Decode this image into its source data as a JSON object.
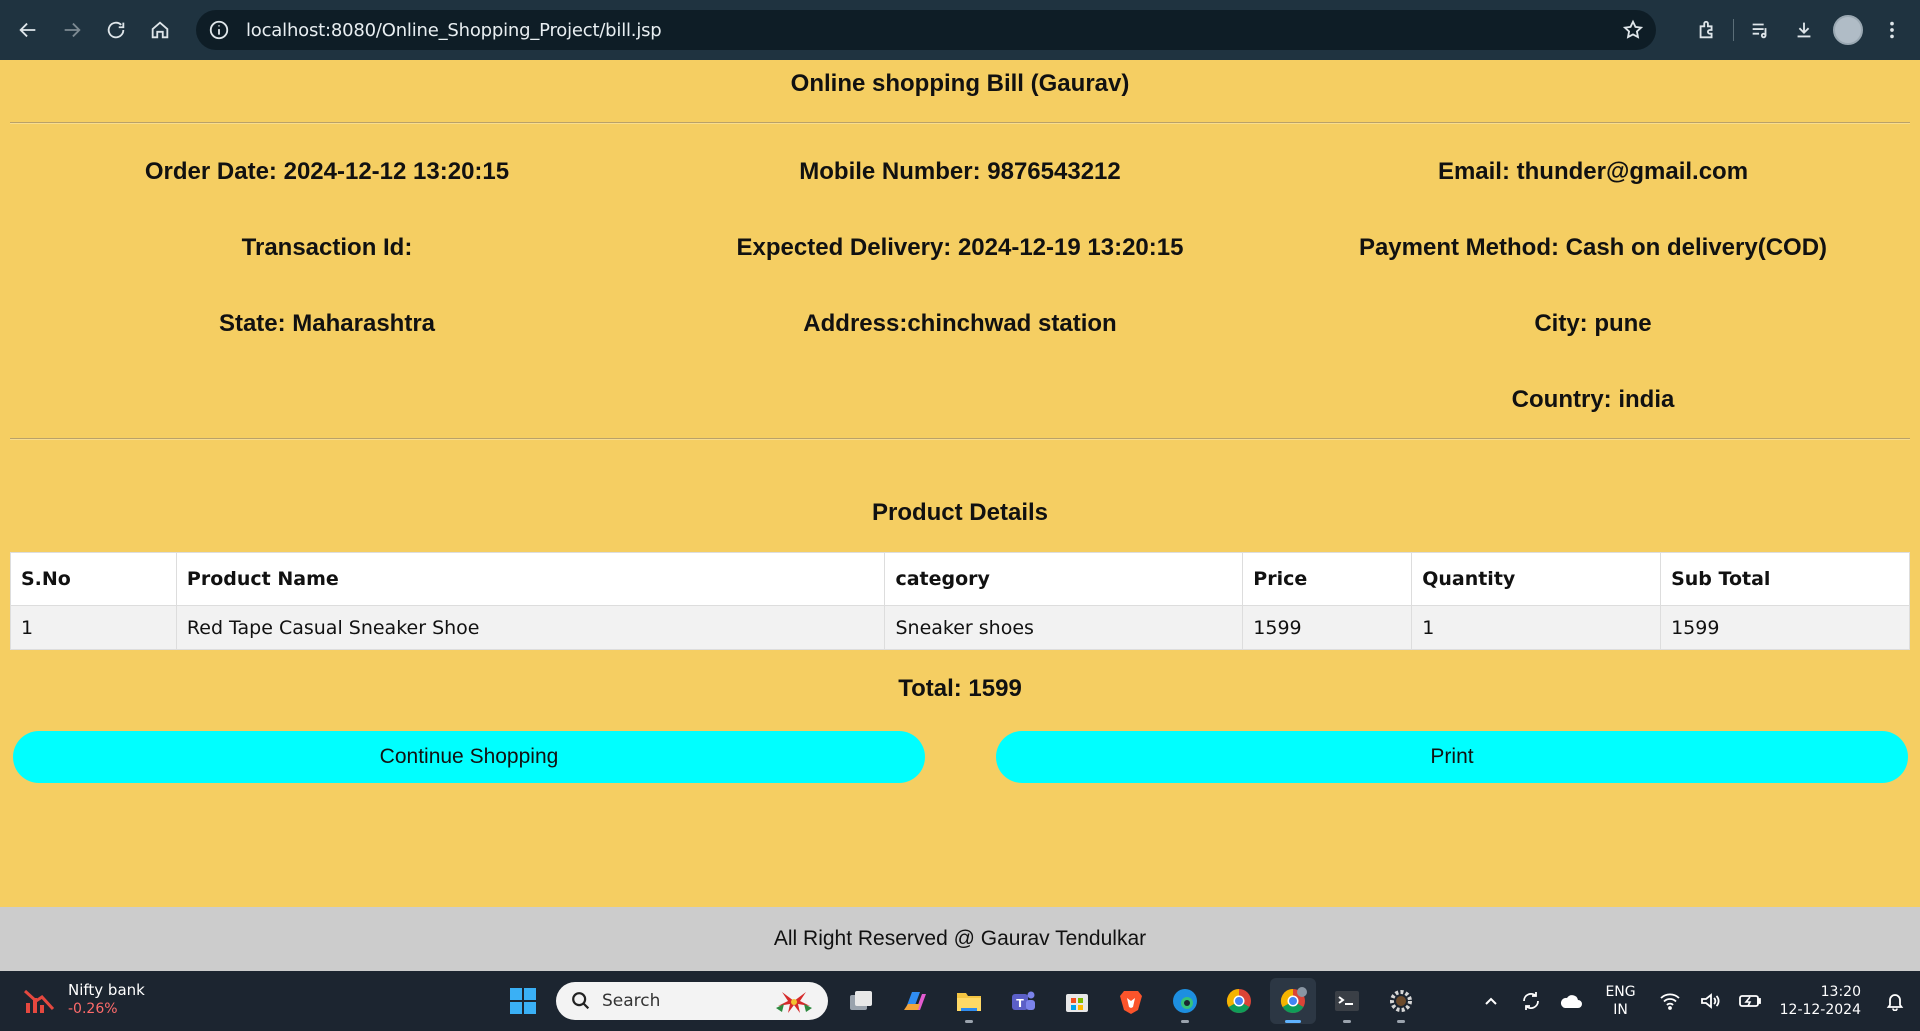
{
  "browser": {
    "url": "localhost:8080/Online_Shopping_Project/bill.jsp"
  },
  "page": {
    "title": "Online shopping Bill (Gaurav)",
    "info": [
      {
        "text": "Order Date: 2024-12-12 13:20:15"
      },
      {
        "text": "Mobile Number: 9876543212"
      },
      {
        "text": "Email: thunder@gmail.com"
      },
      {
        "text": "Transaction Id:"
      },
      {
        "text": "Expected Delivery: 2024-12-19 13:20:15"
      },
      {
        "text": "Payment Method: Cash on delivery(COD)"
      },
      {
        "text": "State: Maharashtra"
      },
      {
        "text": "Address:chinchwad station"
      },
      {
        "text": "City: pune"
      },
      {
        "text": ""
      },
      {
        "text": ""
      },
      {
        "text": "Country: india"
      }
    ],
    "product_details_title": "Product Details",
    "table": {
      "headers": [
        "S.No",
        "Product Name",
        "category",
        "Price",
        "Quantity",
        "Sub Total"
      ],
      "rows": [
        [
          "1",
          "Red Tape Casual Sneaker Shoe",
          "Sneaker shoes",
          "1599",
          "1",
          "1599"
        ]
      ]
    },
    "total": "Total: 1599",
    "continue_button": "Continue Shopping",
    "print_button": "Print"
  },
  "footer": {
    "text": "All Right Reserved @ Gaurav Tendulkar"
  },
  "taskbar": {
    "widget_name": "Nifty bank",
    "widget_value": "-0.26%",
    "search_label": "Search",
    "lang_line1": "ENG",
    "lang_line2": "IN",
    "time": "13:20",
    "date": "12-12-2024"
  },
  "colors": {
    "page_bg": "#f5ce62",
    "button_bg": "#00ffff",
    "footer_bg": "#cccccc",
    "chrome_bg": "#1f3340",
    "taskbar_bg": "#1c2530"
  }
}
